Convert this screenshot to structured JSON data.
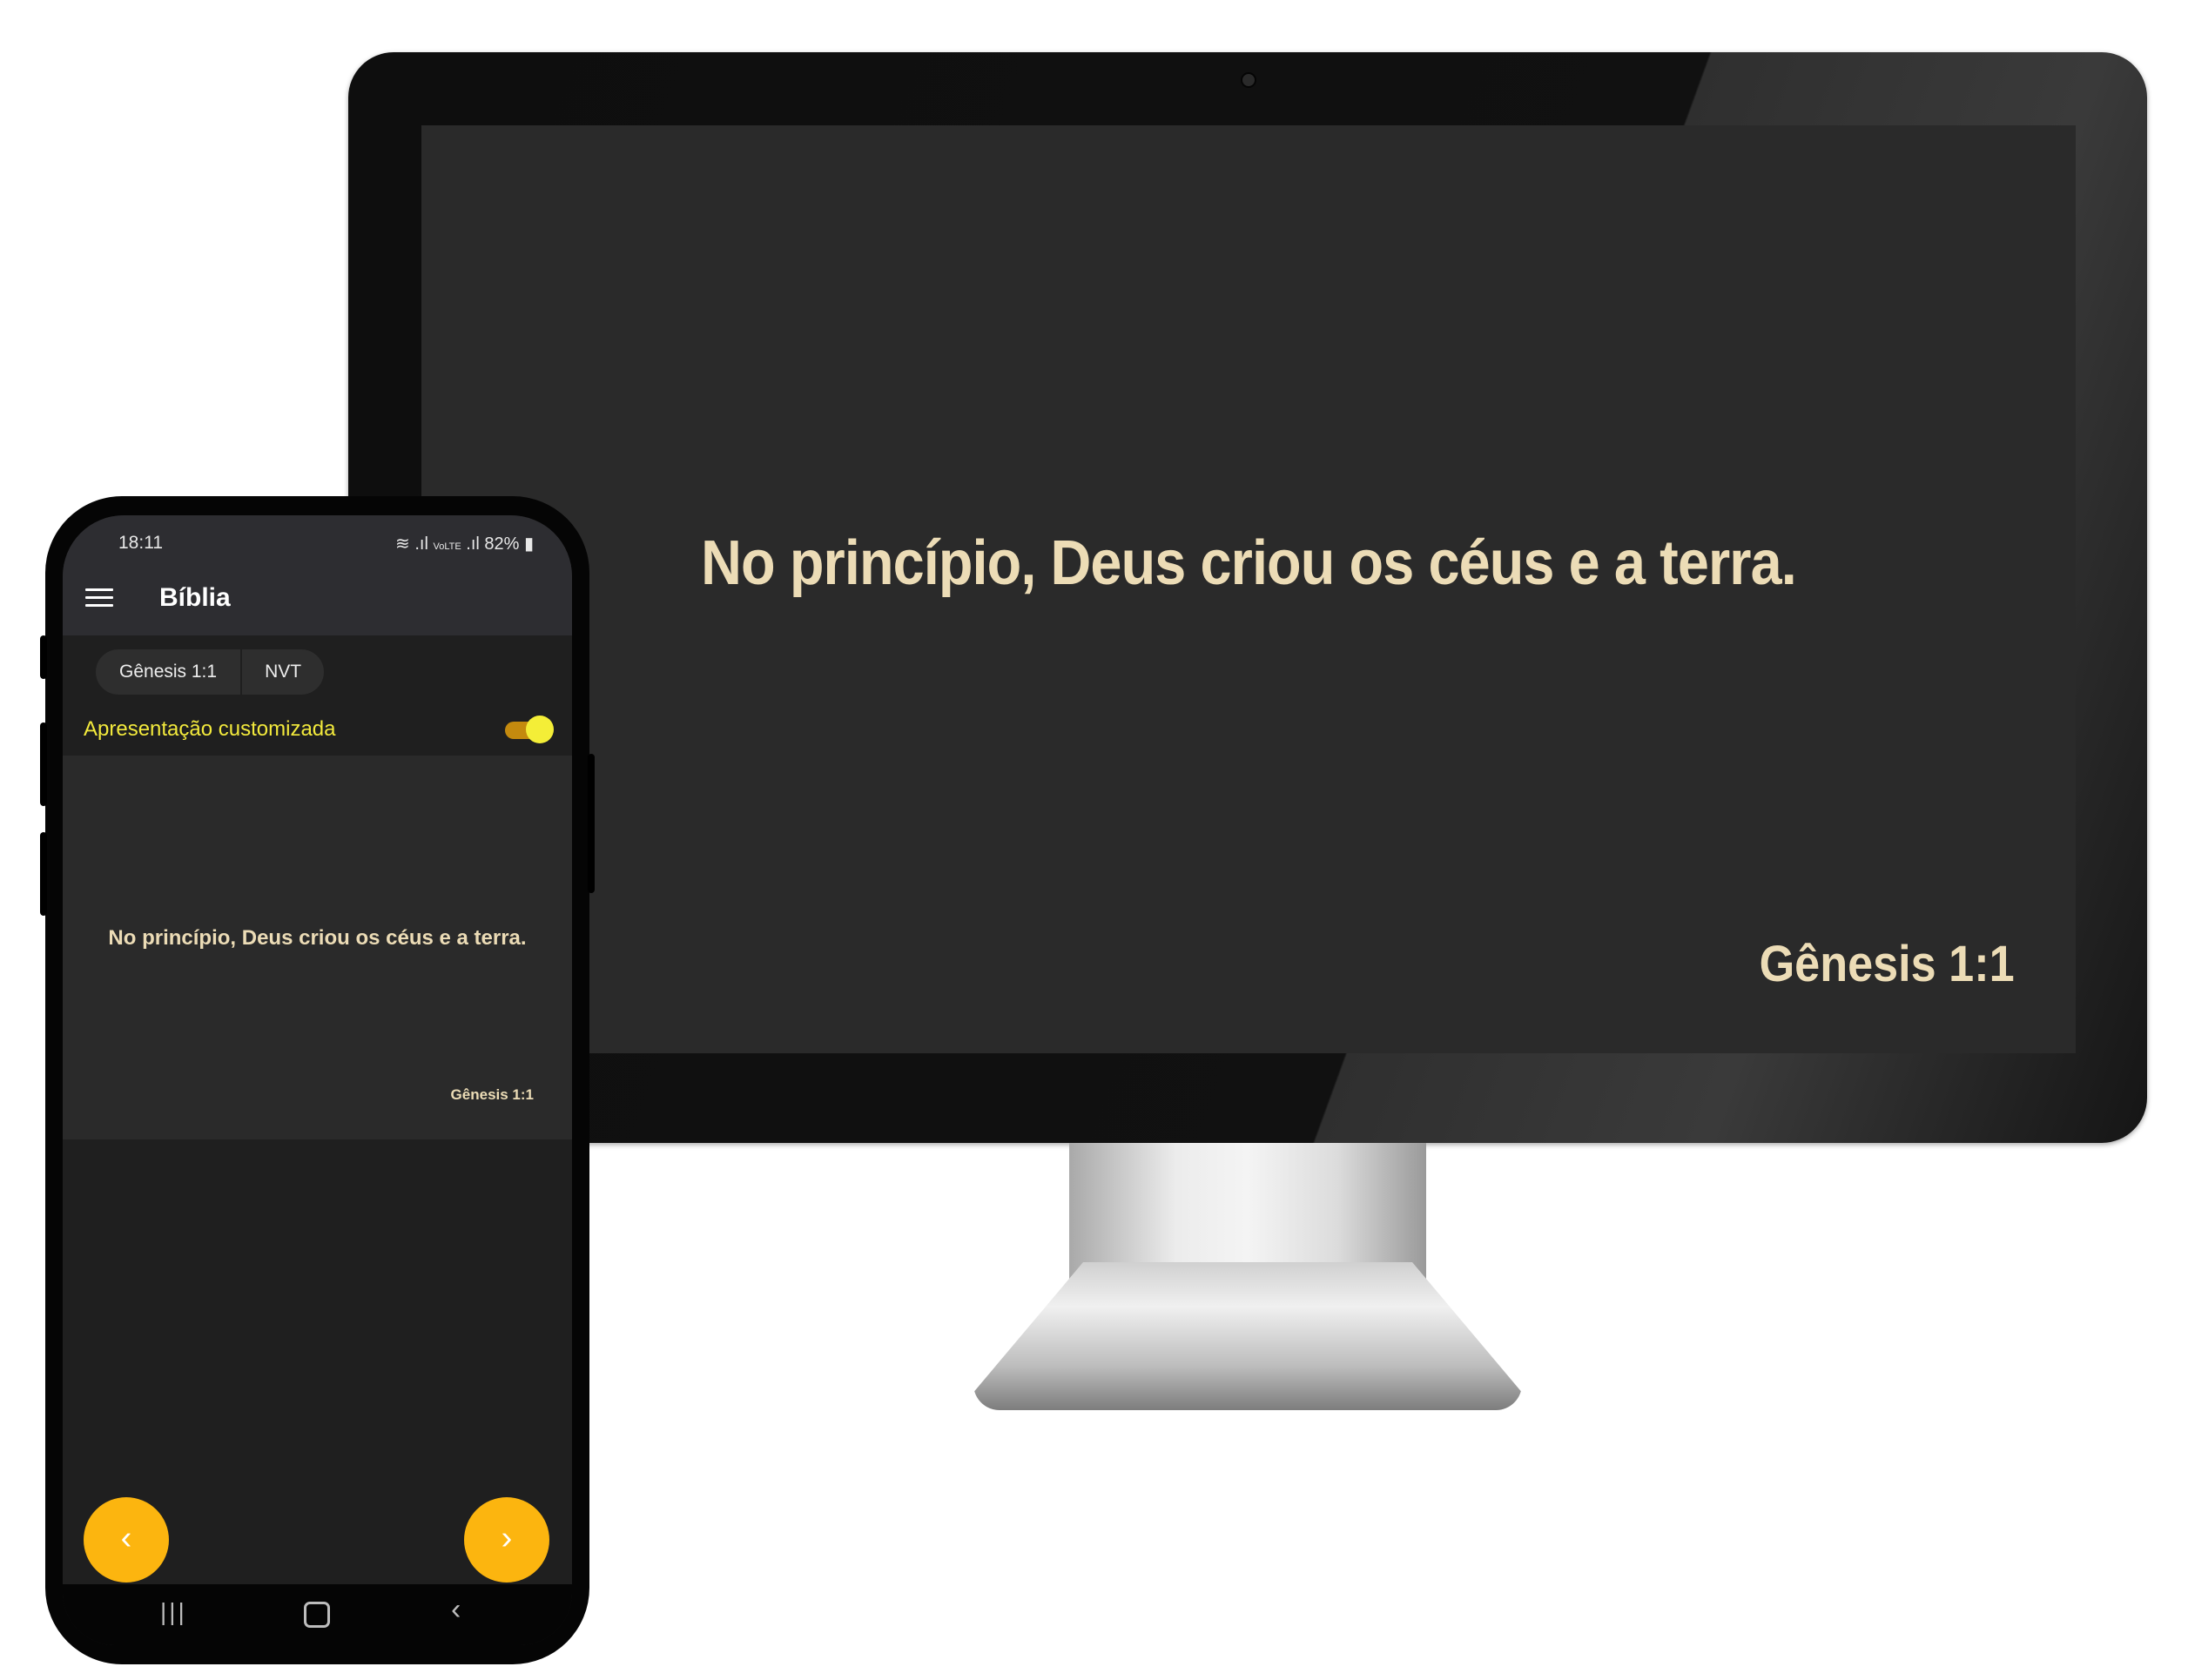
{
  "monitor": {
    "verse_text": "No princípio, Deus criou os céus e a terra.",
    "reference": "Gênesis 1:1"
  },
  "phone": {
    "status_bar": {
      "time": "18:11",
      "battery": "82%",
      "icons": [
        "wifi-icon",
        "signal-icon",
        "volte-icon",
        "signal-icon",
        "battery-icon"
      ]
    },
    "app_bar": {
      "title": "Bíblia",
      "menu_icon": "hamburger-menu-icon"
    },
    "chips": {
      "reference": "Gênesis 1:1",
      "version": "NVT"
    },
    "custom_presentation": {
      "label": "Apresentação customizada",
      "enabled": true
    },
    "preview": {
      "verse_text": "No princípio, Deus criou os céus e a terra.",
      "reference": "Gênesis 1:1"
    },
    "navigation": {
      "prev_symbol": "‹",
      "next_symbol": "›"
    },
    "system_nav": {
      "recents_symbol": "|||",
      "back_symbol": "‹"
    }
  },
  "colors": {
    "accent": "#fcb50f",
    "toggle_label": "#f3ea3c",
    "verse_text": "#ecdcb6",
    "screen_bg": "#2a2a2a",
    "app_bar": "#2d2d31"
  }
}
